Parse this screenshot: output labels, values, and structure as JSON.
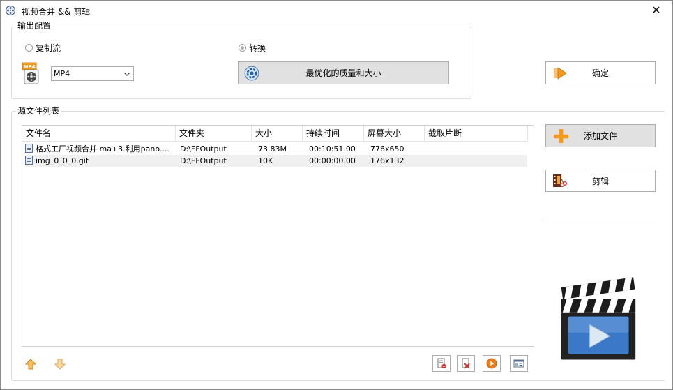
{
  "window": {
    "title": "视频合并 && 剪辑",
    "close_glyph": "✕"
  },
  "output_config": {
    "group_title": "输出配置",
    "copy_stream_label": "复制流",
    "convert_label": "转换",
    "format_value": "MP4",
    "format_icon_label": "MP4",
    "quality_button_label": "最优化的质量和大小",
    "ok_button_label": "确定"
  },
  "source_list": {
    "group_title": "源文件列表",
    "columns": [
      "文件名",
      "文件夹",
      "大小",
      "持续时间",
      "屏幕大小",
      "截取片断"
    ],
    "rows": [
      {
        "name": "格式工厂视频合并 ma+3.利用pano....",
        "folder": "D:\\FFOutput",
        "size": "73.83M",
        "duration": "00:10:51.00",
        "screen": "776x650",
        "clip": ""
      },
      {
        "name": "img_0_0_0.gif",
        "folder": "D:\\FFOutput",
        "size": "10K",
        "duration": "00:00:00.00",
        "screen": "176x132",
        "clip": ""
      }
    ],
    "selected_row": 1
  },
  "side_panel": {
    "add_file_label": "添加文件",
    "edit_label": "剪辑"
  },
  "icons": {
    "app": "film-reel-icon",
    "format": "mp4-film-icon",
    "quality": "settings-gear-icon",
    "ok": "arrow-right-icon",
    "add": "plus-icon",
    "edit": "film-scissors-icon",
    "clapperboard": "clapperboard-play-icon",
    "move_up": "arrow-up-icon",
    "move_down": "arrow-down-icon",
    "remove": "remove-file-icon",
    "clear": "clear-list-icon",
    "play": "play-icon",
    "info": "info-card-icon"
  },
  "colors": {
    "accent_orange": "#f39a1e",
    "button_gray": "#e1e1e1",
    "selected_row": "#f0f0f0",
    "clapper_blue": "#3b78c8"
  }
}
